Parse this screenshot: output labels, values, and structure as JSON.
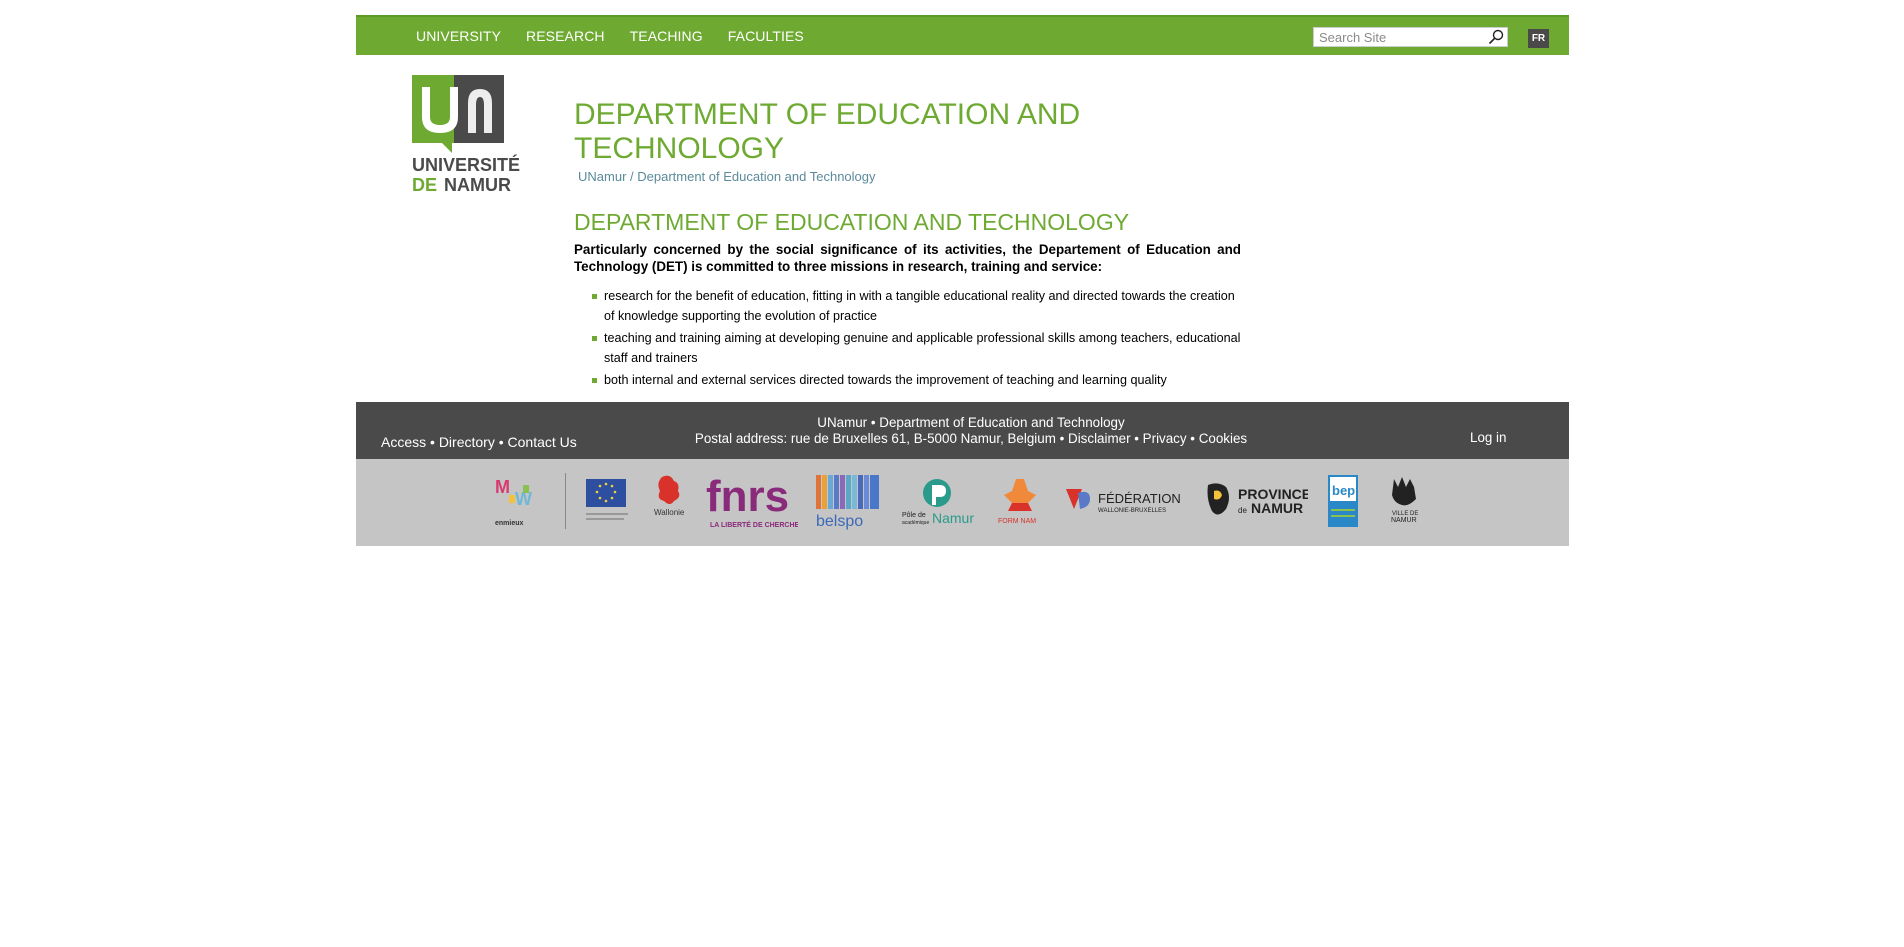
{
  "nav": {
    "items": [
      "UNIVERSITY",
      "RESEARCH",
      "TEACHING",
      "FACULTIES"
    ]
  },
  "search": {
    "placeholder": "Search Site"
  },
  "lang": "FR",
  "logo": {
    "line1": "UNIVERSITÉ",
    "line2a": "DE",
    "line2b": "NAMUR",
    "mark": "un"
  },
  "page": {
    "title": "DEPARTMENT OF EDUCATION AND TECHNOLOGY",
    "breadcrumb": {
      "home": "UNamur",
      "sep": " / ",
      "current": "Department of Education and Technology"
    },
    "section_title": "DEPARTMENT OF EDUCATION AND TECHNOLOGY",
    "intro": "Particularly concerned by the social significance of its activities, the Departement of Education and Technology (DET) is committed to three missions in research, training and service:",
    "missions": [
      "research for the benefit of education, fitting in with a tangible educational reality and directed towards the creation of knowledge supporting the evolution of practice",
      "teaching and training aiming at developing genuine and applicable professional skills among teachers, educational staff and trainers",
      "both internal and external services directed towards the improvement of teaching and learning quality"
    ]
  },
  "footer": {
    "access": "Access",
    "directory": "Directory",
    "contact": "Contact Us",
    "dot": " • ",
    "line1a": "UNamur",
    "line1b": "Department of Education and Technology",
    "address": "Postal address: rue de Bruxelles 61, B-5000 Namur, Belgium",
    "disclaimer": "Disclaimer",
    "privacy": "Privacy",
    "cookies": "Cookies",
    "login": "Log in"
  },
  "partners": {
    "mw": "enmieux",
    "wallonie": "Wallonie",
    "fnrs": "fnrs",
    "fnrs_tag": "LA LIBERTÉ DE CHERCHER",
    "belspo": "belspo",
    "pole_a": "Pôle de",
    "pole_b": "académique",
    "pole_c": "Namur",
    "formanam": "FORM  NAM",
    "federation_a": "FÉDÉRATION",
    "federation_b": "WALLONIE-BRUXELLES",
    "province_a": "PROVINCE",
    "province_b": "de",
    "province_c": "NAMUR",
    "bep": "bep",
    "ville_a": "VILLE DE",
    "ville_b": "NAMUR"
  },
  "colors": {
    "green": "#6eaa32",
    "dark": "#4a4a4a",
    "partner_bg": "#c5c5c5",
    "crumb": "#5b8a9a"
  }
}
